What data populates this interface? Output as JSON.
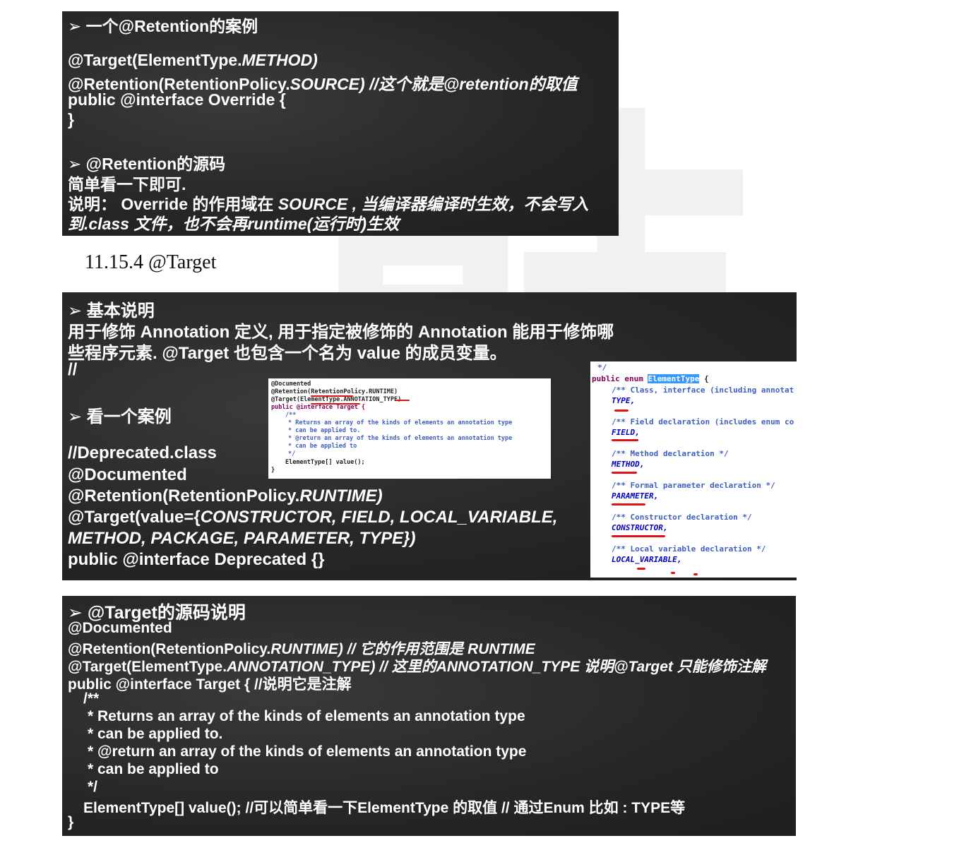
{
  "block1": {
    "heading": "➢ 一个@Retention的案例",
    "l1a": "@Target(ElementType.",
    "l1b": "METHOD)",
    "l2a": "@Retention(RetentionPolicy.",
    "l2b": "SOURCE) //这个就是@retention的取值",
    "l3": "public @interface Override {",
    "l4": "}",
    "heading2": "➢ @Retention的源码",
    "l5": "简单看一下即可.",
    "l6a": "说明：  Override 的作用域在 ",
    "l6b": "SOURCE , 当编译器编译时生效，不会写入",
    "l7": "到.class 文件，也不会再runtime(运行时)生效"
  },
  "section_title": "11.15.4 @Target",
  "block2": {
    "heading": "➢ 基本说明",
    "l1": "用于修饰 Annotation 定义, 用于指定被修饰的 Annotation 能用于修饰哪",
    "l2": "些程序元素. @Target 也包含一个名为 value 的成员变量。",
    "l3": "//",
    "heading2": "➢ 看一个案例",
    "l4": "//Deprecated.class",
    "l5": "@Documented",
    "l6a": "@Retention(RetentionPolicy.",
    "l6b": "RUNTIME)",
    "l7a": "@Target(value={",
    "l7b": "CONSTRUCTOR, FIELD, LOCAL_VARIABLE,",
    "l8": "METHOD, PACKAGE, PARAMETER, TYPE})",
    "l9": "public @interface Deprecated {}"
  },
  "mini_code": {
    "c1": "@Documented",
    "c2": "@Retention(RetentionPolicy.RUNTIME)",
    "c3": "@Target(ElementType.ANNOTATION_TYPE)",
    "c4": "public @interface Target {",
    "c5": "/**",
    "c6": "* Returns an array of the kinds of elements an annotation type",
    "c7": "* can be applied to.",
    "c8": "* @return an array of the kinds of elements an annotation type",
    "c9": "* can be applied to",
    "c10": "*/",
    "c11": "ElementType[] value();",
    "c12": "}"
  },
  "enum_code": {
    "e0": "*/",
    "e1a": "public enum ",
    "e1b": "ElementType",
    "e1c": " {",
    "e2": "/** Class, interface (including annotat",
    "e3": "TYPE,",
    "e4": "/** Field declaration (includes enum co",
    "e5": "FIELD,",
    "e6": "/** Method declaration */",
    "e7": "METHOD,",
    "e8": "/** Formal parameter declaration */",
    "e9": "PARAMETER,",
    "e10": "/** Constructor declaration */",
    "e11": "CONSTRUCTOR,",
    "e12": "/** Local variable declaration */",
    "e13": "LOCAL_VARIABLE,"
  },
  "block3": {
    "heading": "➢ @Target的源码说明",
    "l1": "@Documented",
    "l2a": "@Retention(RetentionPolicy.",
    "l2b": "RUNTIME) // 它的作用范围是  RUNTIME",
    "l3a": "@Target(ElementType.",
    "l3b": "ANNOTATION_TYPE) // 这里的ANNOTATION_TYPE 说明@Target 只能修饰注解",
    "l4": "public @interface Target { //说明它是注解",
    "l5": "/**",
    "l6": "* Returns an array of the kinds of elements an annotation type",
    "l7": "* can be applied to.",
    "l8": "* @return an array of the kinds of elements an annotation type",
    "l9": "* can be applied to",
    "l10": "*/",
    "l11": "ElementType[] value(); //可以简单看一下ElementType 的取值 // 通过Enum 比如 : TYPE等",
    "l12": "}"
  },
  "watermark": "韩"
}
